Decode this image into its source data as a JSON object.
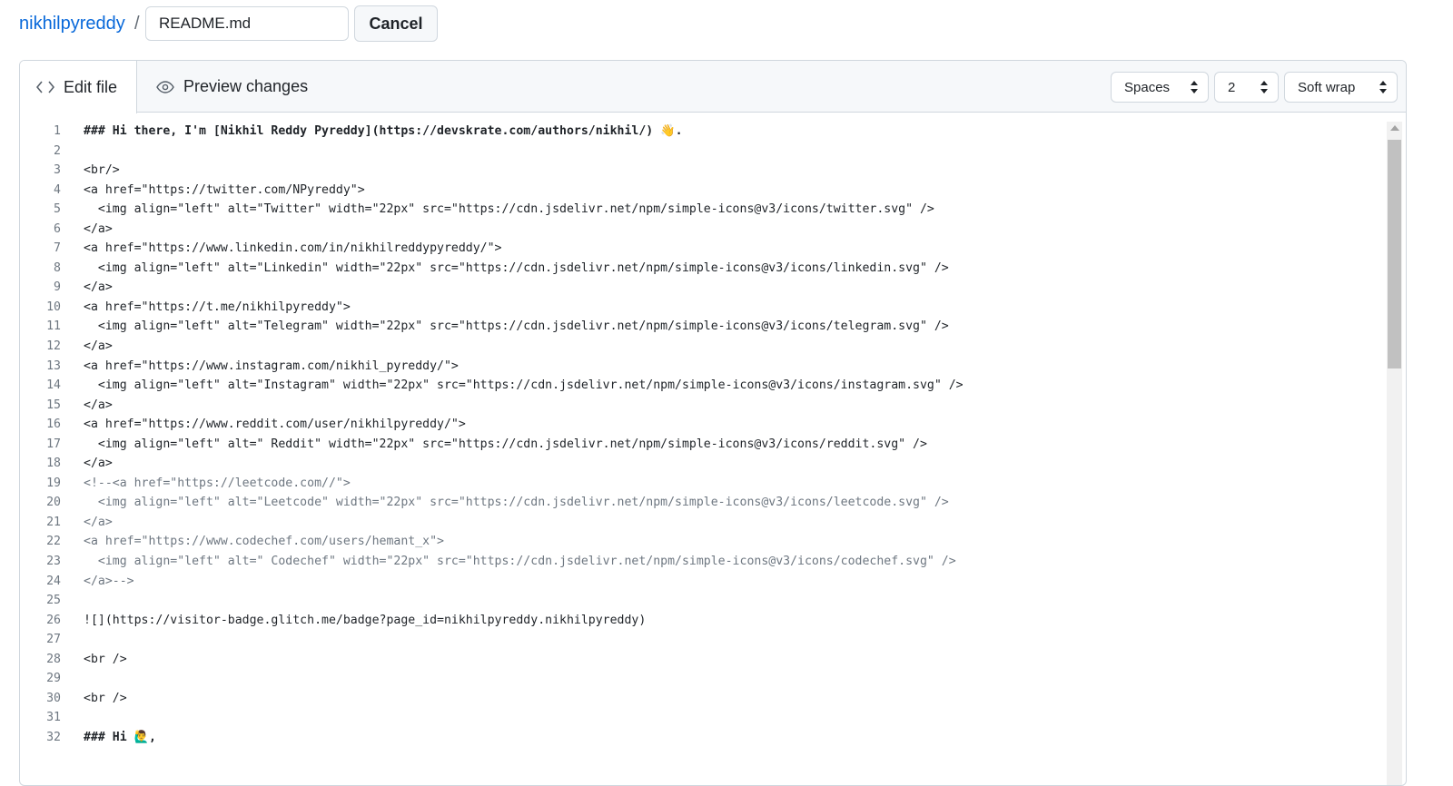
{
  "header": {
    "repo": "nikhilpyreddy",
    "separator": "/",
    "filename": "README.md",
    "cancel_label": "Cancel"
  },
  "tabs": {
    "edit_label": "Edit file",
    "preview_label": "Preview changes",
    "edit_icon": "code-icon",
    "preview_icon": "eye-icon"
  },
  "options": {
    "indent_mode": "Spaces",
    "indent_size": "2",
    "wrap_mode": "Soft wrap"
  },
  "editor": {
    "lines": [
      {
        "n": "1",
        "text": "### Hi there, I'm [Nikhil Reddy Pyreddy](https://devskrate.com/authors/nikhil/) 👋.",
        "style": "bold"
      },
      {
        "n": "2",
        "text": ""
      },
      {
        "n": "3",
        "text": "<br/>"
      },
      {
        "n": "4",
        "text": "<a href=\"https://twitter.com/NPyreddy\">"
      },
      {
        "n": "5",
        "text": "  <img align=\"left\" alt=\"Twitter\" width=\"22px\" src=\"https://cdn.jsdelivr.net/npm/simple-icons@v3/icons/twitter.svg\" />"
      },
      {
        "n": "6",
        "text": "</a>"
      },
      {
        "n": "7",
        "text": "<a href=\"https://www.linkedin.com/in/nikhilreddypyreddy/\">"
      },
      {
        "n": "8",
        "text": "  <img align=\"left\" alt=\"Linkedin\" width=\"22px\" src=\"https://cdn.jsdelivr.net/npm/simple-icons@v3/icons/linkedin.svg\" />"
      },
      {
        "n": "9",
        "text": "</a>"
      },
      {
        "n": "10",
        "text": "<a href=\"https://t.me/nikhilpyreddy\">"
      },
      {
        "n": "11",
        "text": "  <img align=\"left\" alt=\"Telegram\" width=\"22px\" src=\"https://cdn.jsdelivr.net/npm/simple-icons@v3/icons/telegram.svg\" />"
      },
      {
        "n": "12",
        "text": "</a>"
      },
      {
        "n": "13",
        "text": "<a href=\"https://www.instagram.com/nikhil_pyreddy/\">"
      },
      {
        "n": "14",
        "text": "  <img align=\"left\" alt=\"Instagram\" width=\"22px\" src=\"https://cdn.jsdelivr.net/npm/simple-icons@v3/icons/instagram.svg\" />"
      },
      {
        "n": "15",
        "text": "</a>"
      },
      {
        "n": "16",
        "text": "<a href=\"https://www.reddit.com/user/nikhilpyreddy/\">"
      },
      {
        "n": "17",
        "text": "  <img align=\"left\" alt=\" Reddit\" width=\"22px\" src=\"https://cdn.jsdelivr.net/npm/simple-icons@v3/icons/reddit.svg\" />"
      },
      {
        "n": "18",
        "text": "</a>"
      },
      {
        "n": "19",
        "text": "<!--<a href=\"https://leetcode.com//\">",
        "style": "comment"
      },
      {
        "n": "20",
        "text": "  <img align=\"left\" alt=\"Leetcode\" width=\"22px\" src=\"https://cdn.jsdelivr.net/npm/simple-icons@v3/icons/leetcode.svg\" />",
        "style": "comment"
      },
      {
        "n": "21",
        "text": "</a>",
        "style": "comment"
      },
      {
        "n": "22",
        "text": "<a href=\"https://www.codechef.com/users/hemant_x\">",
        "style": "comment"
      },
      {
        "n": "23",
        "text": "  <img align=\"left\" alt=\" Codechef\" width=\"22px\" src=\"https://cdn.jsdelivr.net/npm/simple-icons@v3/icons/codechef.svg\" />",
        "style": "comment"
      },
      {
        "n": "24",
        "text": "</a>-->",
        "style": "comment"
      },
      {
        "n": "25",
        "text": ""
      },
      {
        "n": "26",
        "text": "![](https://visitor-badge.glitch.me/badge?page_id=nikhilpyreddy.nikhilpyreddy)"
      },
      {
        "n": "27",
        "text": ""
      },
      {
        "n": "28",
        "text": "<br />"
      },
      {
        "n": "29",
        "text": ""
      },
      {
        "n": "30",
        "text": "<br />"
      },
      {
        "n": "31",
        "text": ""
      },
      {
        "n": "32",
        "text": "### Hi 🙋‍♂️,",
        "style": "bold"
      }
    ]
  },
  "colors": {
    "link": "#0969da",
    "border": "#d0d7de",
    "muted": "#6e7781"
  }
}
